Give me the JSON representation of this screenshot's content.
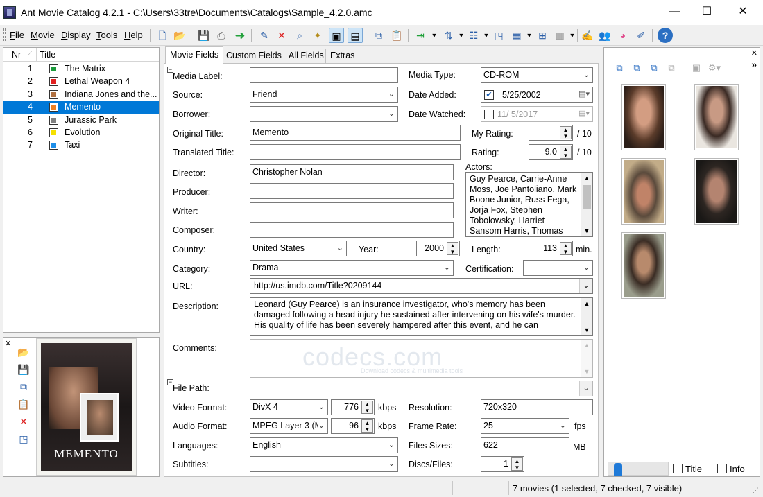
{
  "window": {
    "title": "Ant Movie Catalog 4.2.1 - C:\\Users\\33tre\\Documents\\Catalogs\\Sample_4.2.0.amc",
    "minimize": "—",
    "maximize": "☐",
    "close": "✕"
  },
  "menu": {
    "file": "File",
    "movie": "Movie",
    "display": "Display",
    "tools": "Tools",
    "help": "Help"
  },
  "toolbar_icons": [
    "new-file-icon",
    "open-folder-icon",
    "save-icon",
    "print-icon",
    "next-arrow-icon",
    "add-movie-icon",
    "delete-icon",
    "search-icon",
    "magic-wand-icon",
    "picture-view-icon",
    "copy-view-icon",
    "copy-icon",
    "paste-icon",
    "import-icon",
    "sort-icon",
    "group-icon",
    "window-icon",
    "grid-icon",
    "thumbnail-icon",
    "layout-icon",
    "edit-icon",
    "people-icon",
    "color-icon",
    "script-icon",
    "help-icon"
  ],
  "movie_list": {
    "col_nr": "Nr",
    "col_title": "Title",
    "rows": [
      {
        "nr": "1",
        "title": "The Matrix",
        "color": "#1a9a3a"
      },
      {
        "nr": "2",
        "title": "Lethal Weapon 4",
        "color": "#e12020"
      },
      {
        "nr": "3",
        "title": "Indiana Jones and the...",
        "color": "#b07040"
      },
      {
        "nr": "4",
        "title": "Memento",
        "color": "#f08020"
      },
      {
        "nr": "5",
        "title": "Jurassic Park",
        "color": "#808080"
      },
      {
        "nr": "6",
        "title": "Evolution",
        "color": "#f5e000"
      },
      {
        "nr": "7",
        "title": "Taxi",
        "color": "#1e8ee8"
      }
    ],
    "selected_index": 3
  },
  "poster": {
    "title": "MEMENTO"
  },
  "tabs": [
    "Movie Fields",
    "Custom Fields",
    "All Fields",
    "Extras"
  ],
  "fields": {
    "media_label": {
      "label": "Media Label:",
      "value": ""
    },
    "media_type": {
      "label": "Media Type:",
      "value": "CD-ROM"
    },
    "source": {
      "label": "Source:",
      "value": "Friend"
    },
    "date_added": {
      "label": "Date Added:",
      "value": "5/25/2002",
      "checked": true
    },
    "borrower": {
      "label": "Borrower:",
      "value": ""
    },
    "date_watched": {
      "label": "Date Watched:",
      "value": "11/  5/2017",
      "checked": false
    },
    "original_title": {
      "label": "Original Title:",
      "value": "Memento"
    },
    "my_rating": {
      "label": "My Rating:",
      "value": "",
      "suffix": "/ 10"
    },
    "translated_title": {
      "label": "Translated Title:",
      "value": ""
    },
    "rating": {
      "label": "Rating:",
      "value": "9.0",
      "suffix": "/ 10"
    },
    "director": {
      "label": "Director:",
      "value": "Christopher Nolan"
    },
    "actors": {
      "label": "Actors:",
      "value": "Guy Pearce, Carrie-Anne Moss, Joe Pantoliano, Mark Boone Junior, Russ Fega, Jorja Fox, Stephen Tobolowsky, Harriet Sansom Harris, Thomas"
    },
    "producer": {
      "label": "Producer:",
      "value": ""
    },
    "writer": {
      "label": "Writer:",
      "value": ""
    },
    "composer": {
      "label": "Composer:",
      "value": ""
    },
    "country": {
      "label": "Country:",
      "value": "United States"
    },
    "year": {
      "label": "Year:",
      "value": "2000"
    },
    "length": {
      "label": "Length:",
      "value": "113",
      "suffix": "min."
    },
    "category": {
      "label": "Category:",
      "value": "Drama"
    },
    "certification": {
      "label": "Certification:",
      "value": ""
    },
    "url": {
      "label": "URL:",
      "value": "http://us.imdb.com/Title?0209144"
    },
    "description": {
      "label": "Description:",
      "value": "Leonard (Guy Pearce) is an insurance investigator, who's memory has been damaged following a head injury he sustained after intervening on his wife's murder. His quality of life has been severely hampered after this event, and he can"
    },
    "comments": {
      "label": "Comments:",
      "value": ""
    },
    "file_path": {
      "label": "File Path:",
      "value": ""
    },
    "video_format": {
      "label": "Video Format:",
      "value": "DivX 4"
    },
    "video_bitrate": {
      "value": "776",
      "unit": "kbps"
    },
    "resolution": {
      "label": "Resolution:",
      "value": "720x320"
    },
    "audio_format": {
      "label": "Audio Format:",
      "value": "MPEG Layer 3 (M"
    },
    "audio_bitrate": {
      "value": "96",
      "unit": "kbps"
    },
    "frame_rate": {
      "label": "Frame Rate:",
      "value": "25",
      "unit": "fps"
    },
    "languages": {
      "label": "Languages:",
      "value": "English"
    },
    "file_sizes": {
      "label": "Files Sizes:",
      "value": "622",
      "unit": "MB"
    },
    "subtitles": {
      "label": "Subtitles:",
      "value": ""
    },
    "discs": {
      "label": "Discs/Files:",
      "value": "1"
    }
  },
  "watermark": {
    "text": "codecs.com",
    "sub": "Download codecs & multimedia tools"
  },
  "right_panel": {
    "actor_photos": 5,
    "title_checkbox": "Title",
    "info_checkbox": "Info",
    "expand": "»",
    "slider_level": 0.1
  },
  "status": {
    "text": "7 movies (1 selected, 7 checked, 7 visible)"
  }
}
